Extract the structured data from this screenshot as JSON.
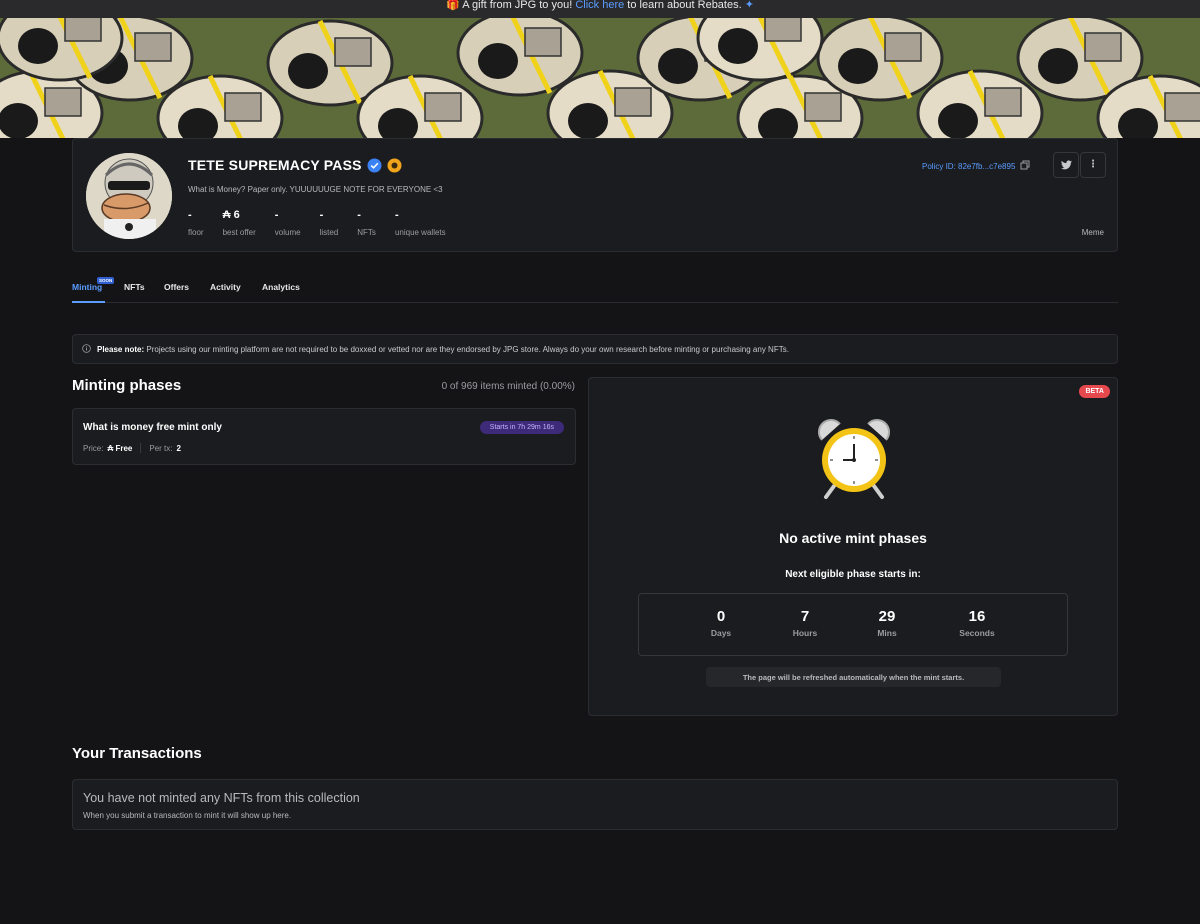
{
  "announcement": {
    "prefix": "A gift from JPG to you!",
    "link": "Click here",
    "suffix": "to learn about Rebates."
  },
  "collection": {
    "title": "TETE SUPREMACY PASS",
    "description": "What is Money? Paper only. YUUUUUUGE NOTE FOR EVERYONE <3",
    "policy_id": "Policy ID: 82e7fb...c7e895",
    "category": "Meme",
    "stats": [
      {
        "value": "-",
        "label": "floor"
      },
      {
        "value": "₳ 6",
        "label": "best offer"
      },
      {
        "value": "-",
        "label": "volume"
      },
      {
        "value": "-",
        "label": "listed"
      },
      {
        "value": "-",
        "label": "NFTs"
      },
      {
        "value": "-",
        "label": "unique wallets"
      }
    ]
  },
  "tabs": {
    "minting": "Minting",
    "soon": "SOON",
    "nfts": "NFTs",
    "offers": "Offers",
    "activity": "Activity",
    "analytics": "Analytics"
  },
  "note": {
    "bold": "Please note:",
    "text": "Projects using our minting platform are not required to be doxxed or vetted nor are they endorsed by JPG store. Always do your own research before minting or purchasing any NFTs."
  },
  "minting": {
    "title": "Minting phases",
    "count": "0 of 969 items minted (0.00%)",
    "phase": {
      "name": "What is money free mint only",
      "starts": "Starts in 7h 29m 16s",
      "price_label": "Price:",
      "price_value": "₳ Free",
      "per_tx_label": "Per tx:",
      "per_tx_value": "2"
    }
  },
  "mint_card": {
    "beta": "BETA",
    "no_active": "No active mint phases",
    "next_phase": "Next eligible phase starts in:",
    "countdown": [
      {
        "value": "0",
        "label": "Days"
      },
      {
        "value": "7",
        "label": "Hours"
      },
      {
        "value": "29",
        "label": "Mins"
      },
      {
        "value": "16",
        "label": "Seconds"
      }
    ],
    "refresh_note": "The page will be refreshed automatically when the mint starts."
  },
  "transactions": {
    "title": "Your Transactions",
    "empty_title": "You have not minted any NFTs from this collection",
    "empty_sub": "When you submit a transaction to mint it will show up here."
  },
  "colors": {
    "accent": "#5a9cff",
    "background": "#141416",
    "card": "#1b1c1f",
    "beta": "#e5484d",
    "phase_badge": "#3d2a78"
  }
}
